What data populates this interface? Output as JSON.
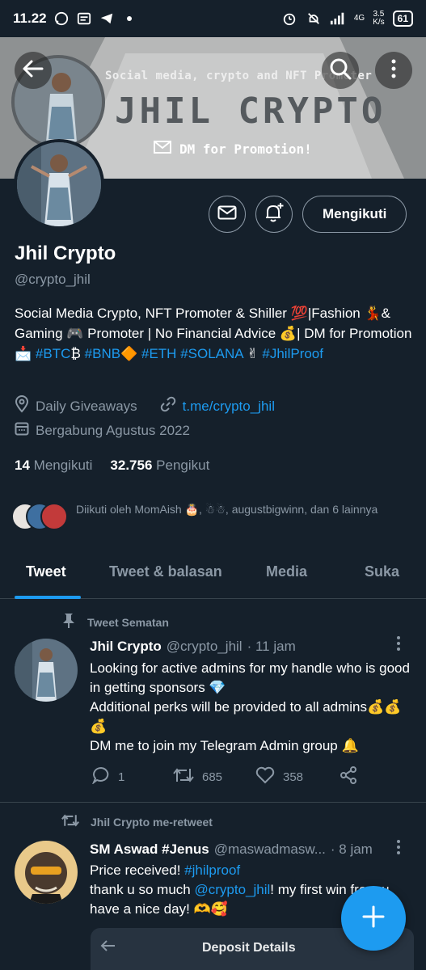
{
  "status_bar": {
    "time": "11.22",
    "network_type": "4G",
    "net_speed_value": "3.5",
    "net_speed_unit": "K/s",
    "battery": "61"
  },
  "banner": {
    "tagline": "Social media, crypto and NFT Promoter",
    "title": "JHIL CRYPTO",
    "dm_text": "DM for Promotion!"
  },
  "profile": {
    "follow_label": "Mengikuti",
    "name": "Jhil Crypto",
    "handle": "@crypto_jhil",
    "bio": [
      {
        "text": "Social Media Crypto, NFT Promoter & Shiller 💯|Fashion 💃& Gaming 🎮 Promoter | No Financial Advice 💰| DM for Promotion 📩 ",
        "link": false
      },
      {
        "text": "#BTC",
        "link": true
      },
      {
        "text": "₿  ",
        "link": false
      },
      {
        "text": "#BNB",
        "link": true
      },
      {
        "text": "🔶  ",
        "link": false
      },
      {
        "text": "#ETH",
        "link": true
      },
      {
        "text": " ",
        "link": false
      },
      {
        "text": "#SOLANA",
        "link": true
      },
      {
        "text": " ✌ ",
        "link": false
      },
      {
        "text": "#JhilProof",
        "link": true
      }
    ],
    "location": "Daily Giveaways",
    "website": "t.me/crypto_jhil",
    "joined": "Bergabung Agustus 2022",
    "following_count": "14",
    "following_label": "Mengikuti",
    "followers_count": "32.756",
    "followers_label": "Pengikut",
    "followed_by": "Diikuti oleh MomAish 🎂, ☃☃, augustbigwinn, dan 6 lainnya"
  },
  "tabs": [
    "Tweet",
    "Tweet & balasan",
    "Media",
    "Suka"
  ],
  "tweets": [
    {
      "context": "Tweet Sematan",
      "name": "Jhil Crypto",
      "handle": "@crypto_jhil",
      "time": "· 11 jam",
      "body": "Looking for active admins for my handle who is good in getting sponsors 💎\nAdditional perks will be provided to all admins💰💰💰\nDM me to join my Telegram Admin group 🔔",
      "replies": "1",
      "retweets": "685",
      "likes": "358"
    },
    {
      "context": "Jhil Crypto me-retweet",
      "name": "SM Aswad #Jenus",
      "handle": "@maswadmasw...",
      "time": "· 8 jam",
      "body_parts": [
        {
          "text": "Price received! ",
          "link": false
        },
        {
          "text": "#jhilproof",
          "link": true
        },
        {
          "text": "\nthank u so much ",
          "link": false
        },
        {
          "text": "@crypto_jhil",
          "link": true
        },
        {
          "text": "! my first win from u. have a nice day! 🫶🥰",
          "link": false
        }
      ],
      "card_title": "Deposit Details"
    }
  ],
  "colors": {
    "background": "#15202b",
    "accent": "#1d9bf0",
    "muted": "#8b98a5",
    "border": "#38444d"
  }
}
